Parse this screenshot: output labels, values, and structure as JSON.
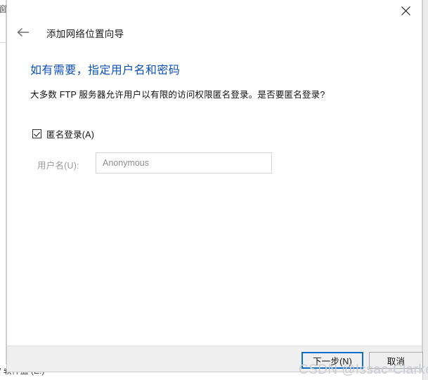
{
  "window": {
    "title": "添加网络位置向导",
    "back_icon": "back-arrow-icon",
    "close_icon": "close-x-icon"
  },
  "content": {
    "heading": "如有需要，指定用户名和密码",
    "description": "大多数 FTP 服务器允许用户以有限的访问权限匿名登录。是否要匿名登录?",
    "anonymous_checkbox": {
      "label": "匿名登录(A)",
      "checked": true
    },
    "username_field": {
      "label": "用户名(U):",
      "value": "Anonymous",
      "placeholder": "Anonymous",
      "disabled": true
    }
  },
  "footer": {
    "next_label": "下一步(N)",
    "cancel_label": "取消"
  },
  "watermark": {
    "text": "CSDN @Issac-Clarke"
  },
  "background": {
    "sliver_text": "窗",
    "bottom_text": "/ 软件盘 (E:)"
  },
  "colors": {
    "heading_blue": "#0d51b5",
    "focus_border_blue": "#0b6ec9",
    "footer_background": "#efefef",
    "dialog_background": "#ffffff",
    "disabled_text": "#9a9a9a",
    "watermark_gray": "#c9ccd2"
  }
}
